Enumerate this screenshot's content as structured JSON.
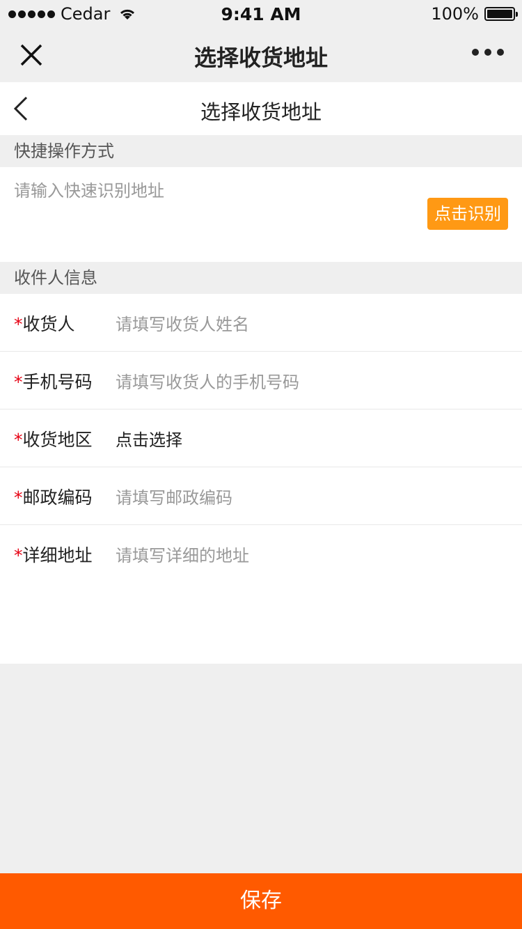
{
  "status_bar": {
    "carrier": "Cedar",
    "time": "9:41 AM",
    "battery": "100%"
  },
  "nav": {
    "title": "选择收货地址"
  },
  "page_header": {
    "title": "选择收货地址"
  },
  "quick_section": {
    "label": "快捷操作方式",
    "placeholder": "请输入快速识别地址",
    "button": "点击识别"
  },
  "receiver_section": {
    "label": "收件人信息",
    "rows": [
      {
        "required": "*",
        "label": "收货人",
        "value": "请填写收货人姓名"
      },
      {
        "required": "*",
        "label": "手机号码",
        "value": "请填写收货人的手机号码"
      },
      {
        "required": "*",
        "label": "收货地区",
        "value": "点击选择"
      },
      {
        "required": "*",
        "label": "邮政编码",
        "value": "请填写邮政编码"
      },
      {
        "required": "*",
        "label": "详细地址",
        "value": "请填写详细的地址"
      }
    ]
  },
  "save_button": "保存",
  "colors": {
    "recognize_button": "#ff9914",
    "save_bar": "#ff5a00",
    "required_star": "#e60012"
  }
}
